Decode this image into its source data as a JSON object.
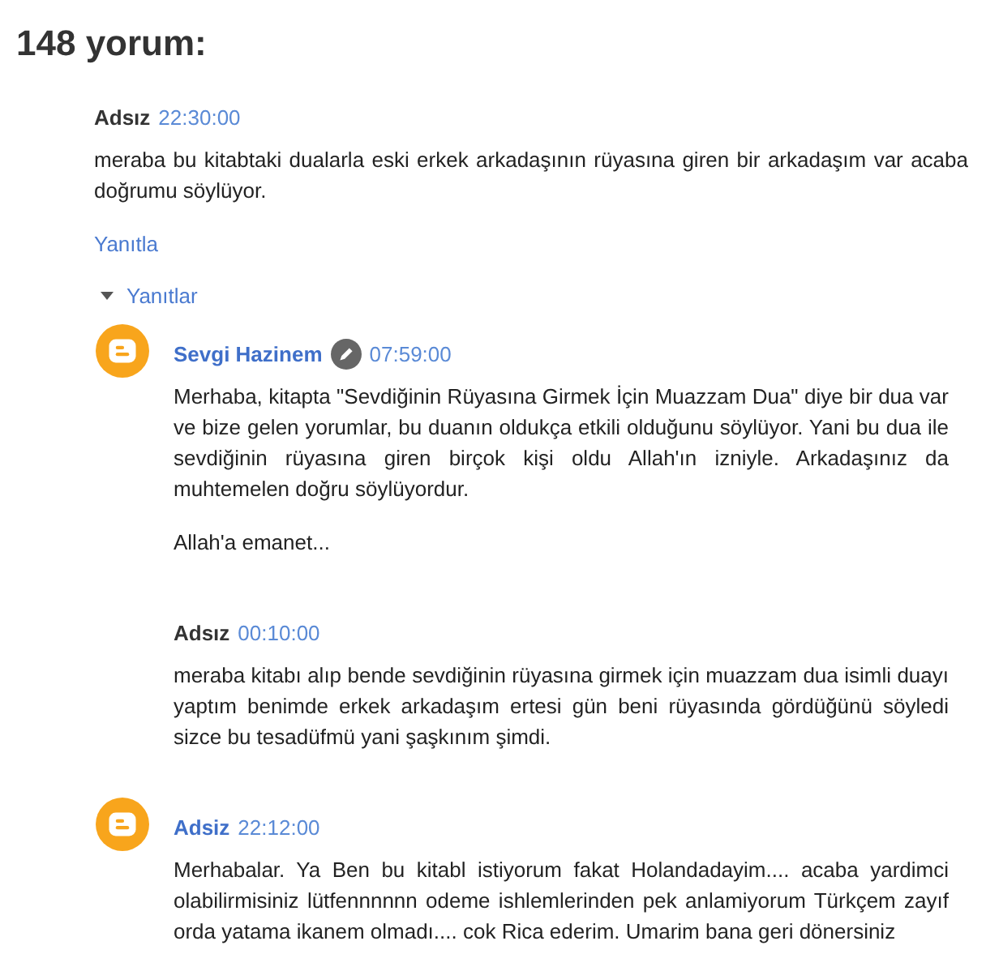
{
  "heading": "148 yorum:",
  "comments": [
    {
      "author": "Adsız",
      "author_linked": false,
      "avatar": false,
      "admin": false,
      "time": "22:30:00",
      "paragraphs": [
        "meraba bu kitabtaki dualarla eski erkek arkadaşının rüyasına giren bir arkadaşım var acaba doğrumu söylüyor."
      ],
      "reply_link": "Yanıtla",
      "replies_toggle": {
        "label": "Yanıtlar",
        "expanded": true
      },
      "children": [
        {
          "author": "Sevgi Hazinem",
          "author_linked": true,
          "avatar": true,
          "admin": true,
          "time": "07:59:00",
          "paragraphs": [
            "Merhaba, kitapta \"Sevdiğinin Rüyasına Girmek İçin Muazzam Dua\" diye bir dua var ve bize gelen yorumlar, bu duanın oldukça etkili olduğunu söylüyor. Yani bu dua ile sevdiğinin rüyasına giren birçok kişi oldu Allah'ın izniyle. Arkadaşınız da muhtemelen doğru söylüyordur.",
            "Allah'a emanet..."
          ]
        },
        {
          "author": "Adsız",
          "author_linked": false,
          "avatar": false,
          "admin": false,
          "time": "00:10:00",
          "paragraphs": [
            "meraba kitabı alıp bende sevdiğinin rüyasına girmek için muazzam dua isimli duayı yaptım benimde erkek arkadaşım ertesi gün beni rüyasında gördüğünü söyledi sizce bu tesadüfmü yani şaşkınım şimdi."
          ]
        },
        {
          "author": "Adsiz",
          "author_linked": true,
          "avatar": true,
          "admin": false,
          "time": "22:12:00",
          "paragraphs": [
            "Merhabalar. Ya Ben bu kitabl istiyorum fakat Holandadayim.... acaba yardimci olabilirmisiniz lütfennnnnn odeme ishlemlerinden pek anlamiyorum Türkçem zayıf orda yatama ikanem olmadı.... cok Rica ederim. Umarim bana geri dönersiniz"
          ]
        }
      ]
    }
  ]
}
